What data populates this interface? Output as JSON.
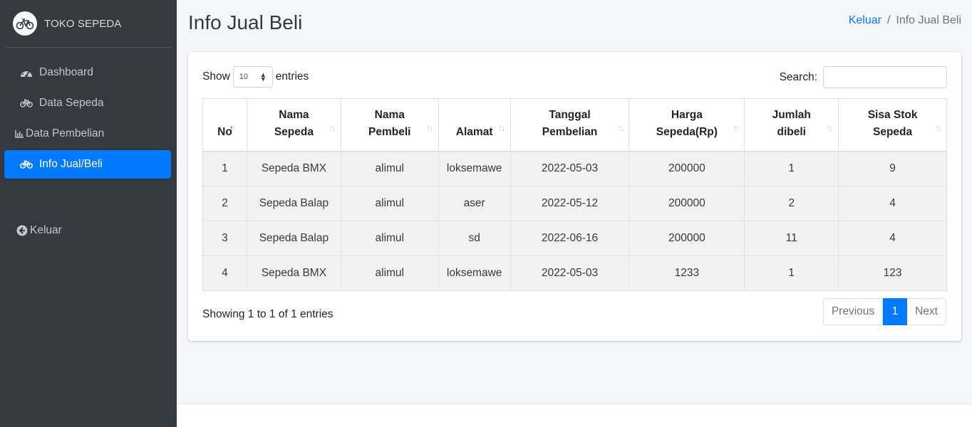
{
  "brand": {
    "name": "TOKO SEPEDA",
    "logo_icon": "bicycle-logo"
  },
  "sidebar": {
    "items": [
      {
        "label": "Dashboard",
        "icon": "tachometer-icon"
      },
      {
        "label": "Data Sepeda",
        "icon": "bicycle-icon"
      },
      {
        "label": "Data Pembelian",
        "icon": "bar-chart-icon"
      },
      {
        "label": "Info Jual/Beli",
        "icon": "bicycle-icon",
        "active": true
      }
    ],
    "logout": {
      "label": "Keluar",
      "icon": "arrow-circle-left-icon"
    }
  },
  "header": {
    "title": "Info Jual Beli",
    "breadcrumb": {
      "link": "Keluar",
      "separator": "/",
      "current": "Info Jual Beli"
    }
  },
  "table_controls": {
    "show_label": "Show",
    "entries_value": "10",
    "entries_label": "entries",
    "search_label": "Search:",
    "search_value": ""
  },
  "table": {
    "headers": [
      {
        "line1": "No",
        "line2": ""
      },
      {
        "line1": "Nama",
        "line2": "Sepeda"
      },
      {
        "line1": "Nama",
        "line2": "Pembeli"
      },
      {
        "line1": "Alamat",
        "line2": ""
      },
      {
        "line1": "Tanggal",
        "line2": "Pembelian"
      },
      {
        "line1": "Harga",
        "line2": "Sepeda(Rp)"
      },
      {
        "line1": "Jumlah",
        "line2": "dibeli"
      },
      {
        "line1": "Sisa Stok",
        "line2": "Sepeda"
      }
    ],
    "rows": [
      [
        "1",
        "Sepeda BMX",
        "alimul",
        "loksemawe",
        "2022-05-03",
        "200000",
        "1",
        "9"
      ],
      [
        "2",
        "Sepeda Balap",
        "alimul",
        "aser",
        "2022-05-12",
        "200000",
        "2",
        "4"
      ],
      [
        "3",
        "Sepeda Balap",
        "alimul",
        "sd",
        "2022-06-16",
        "200000",
        "11",
        "4"
      ],
      [
        "4",
        "Sepeda BMX",
        "alimul",
        "loksemawe",
        "2022-05-03",
        "1233",
        "1",
        "123"
      ]
    ]
  },
  "footer_info": "Showing 1 to 1 of 1 entries",
  "pagination": {
    "previous": "Previous",
    "current": "1",
    "next": "Next"
  },
  "colors": {
    "sidebar": "#343a40",
    "accent": "#007bff",
    "background": "#f4f6f9"
  }
}
